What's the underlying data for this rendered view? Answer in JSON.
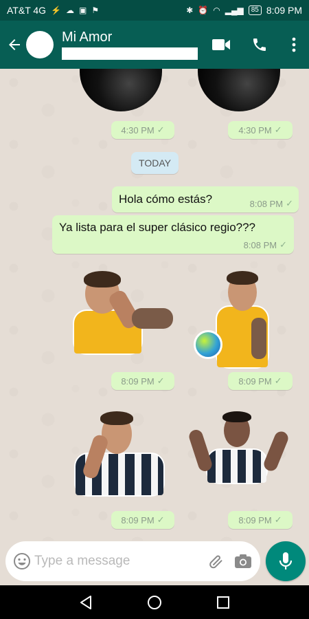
{
  "status_bar": {
    "carrier": "AT&T 4G",
    "battery": "85",
    "time": "8:09 PM"
  },
  "header": {
    "contact_name": "Mi Amor"
  },
  "messages": {
    "prev_time_left": "4:30 PM",
    "prev_time_right": "4:30 PM",
    "date_divider": "TODAY",
    "msg1_text": "Hola cómo estás?",
    "msg1_time": "8:08 PM",
    "msg2_text": "Ya lista para el super clásico regio???",
    "msg2_time": "8:08 PM",
    "sticker1_time": "8:09 PM",
    "sticker2_time": "8:09 PM",
    "sticker3_time": "8:09 PM",
    "sticker4_time": "8:09 PM"
  },
  "composer": {
    "placeholder": "Type a message"
  },
  "colors": {
    "header": "#075e54",
    "status_bar": "#054d44",
    "outgoing_bubble": "#dcf8c6",
    "accent": "#00897b"
  },
  "icons": {
    "back": "arrow-left-icon",
    "video": "video-camera-icon",
    "call": "phone-icon",
    "menu": "more-vertical-icon",
    "emoji": "emoji-icon",
    "attach": "paperclip-icon",
    "camera": "camera-icon",
    "mic": "microphone-icon"
  }
}
